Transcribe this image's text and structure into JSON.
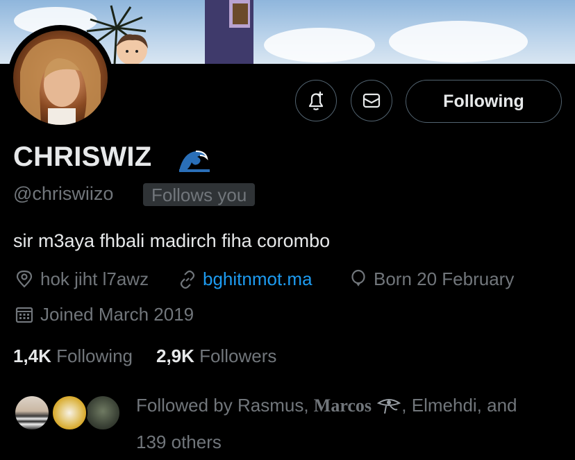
{
  "profile": {
    "name": "CHRISWIZ",
    "name_emoji": "wave-emoji",
    "handle": "@chriswiizo",
    "follows_you": "Follows you",
    "bio": "sir m3aya fhbali madirch fiha corombo",
    "location": "hok jiht l7awz",
    "website": "bghitnmot.ma",
    "birthday": "Born 20 February",
    "joined": "Joined March 2019"
  },
  "actions": {
    "notify_icon": "bell-plus-icon",
    "message_icon": "envelope-icon",
    "follow_label": "Following"
  },
  "stats": {
    "following_count": "1,4K",
    "following_label": "Following",
    "followers_count": "2,9K",
    "followers_label": "Followers"
  },
  "followed_by": {
    "prefix": "Followed by",
    "name1": "Rasmus,",
    "name2": "Marcos",
    "name2_emoji": "eye-of-horus-emoji",
    "name3": ", Elmehdi, and",
    "others": "139 others"
  },
  "colors": {
    "background": "#000000",
    "primary_text": "#e7e9ea",
    "secondary_text": "#71767b",
    "link": "#1d9bf0",
    "border": "#536471"
  }
}
